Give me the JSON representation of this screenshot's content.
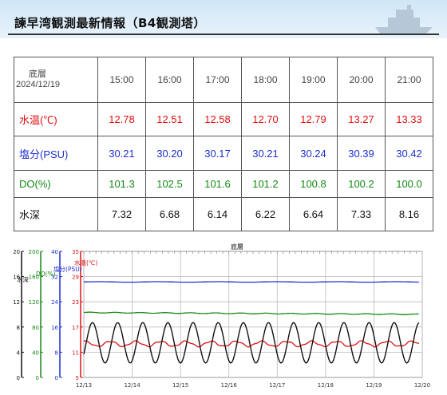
{
  "header": {
    "title": "諫早湾観測最新情報（B4観測塔）"
  },
  "table": {
    "layer": "底層",
    "date": "2024/12/19",
    "times": [
      "15:00",
      "16:00",
      "17:00",
      "18:00",
      "19:00",
      "20:00",
      "21:00"
    ],
    "rows": [
      {
        "label": "水温(℃)",
        "values": [
          "12.78",
          "12.51",
          "12.58",
          "12.70",
          "12.79",
          "13.27",
          "13.33"
        ]
      },
      {
        "label": "塩分(PSU)",
        "values": [
          "30.21",
          "30.20",
          "30.17",
          "30.21",
          "30.24",
          "30.39",
          "30.42"
        ]
      },
      {
        "label": "DO(%)",
        "values": [
          "101.3",
          "102.5",
          "101.6",
          "101.2",
          "100.8",
          "100.2",
          "100.0"
        ]
      },
      {
        "label": "水深",
        "values": [
          "7.32",
          "6.68",
          "6.14",
          "6.22",
          "6.64",
          "7.33",
          "8.16"
        ]
      }
    ]
  },
  "colors": {
    "temp": "#e01010",
    "salinity": "#1f2fd0",
    "do": "#138a13",
    "depth": "#111111"
  },
  "chart_data": {
    "type": "line",
    "title": "底層",
    "x": [
      "12/13",
      "12/14",
      "12/15",
      "12/16",
      "12/17",
      "12/18",
      "12/19",
      "12/20"
    ],
    "axes": [
      {
        "name": "水深",
        "ticks": [
          "0",
          "4",
          "8",
          "12",
          "16",
          "20"
        ],
        "ylim": [
          0,
          20
        ]
      },
      {
        "name": "DO(%)",
        "ticks": [
          "0",
          "40",
          "80",
          "120",
          "160",
          "200"
        ],
        "ylim": [
          0,
          200
        ]
      },
      {
        "name": "塩分(PSU)",
        "ticks": [
          "0",
          "8",
          "16",
          "24",
          "32",
          "40"
        ],
        "ylim": [
          0,
          40
        ]
      },
      {
        "name": "水温(℃)",
        "ticks": [
          "5",
          "11",
          "17",
          "23",
          "29",
          "35"
        ],
        "ylim": [
          5,
          35
        ]
      }
    ],
    "series": [
      {
        "name": "塩分(PSU)",
        "level": 30.3
      },
      {
        "name": "DO(%)",
        "start": 103,
        "end": 100
      },
      {
        "name": "水温(℃)",
        "mean": 13.0,
        "amplitude": 0.6
      },
      {
        "name": "水深",
        "mean": 5.5,
        "amplitude": 3.2,
        "period_days": 0.52
      }
    ],
    "grid": true
  }
}
